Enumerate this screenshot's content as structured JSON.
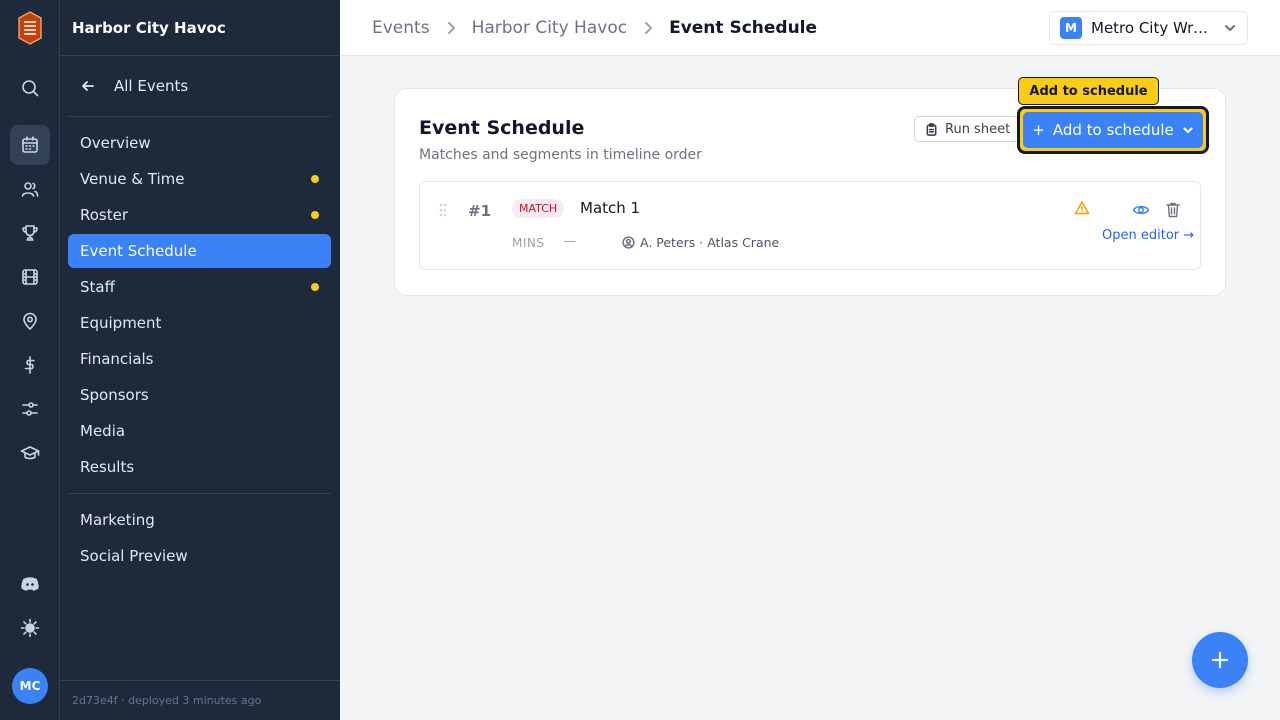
{
  "app": {
    "event_name": "Harbor City Havoc",
    "deploy_info": "2d73e4f · deployed 3 minutes ago",
    "user_initials": "MC"
  },
  "rail": {
    "icons": [
      "search-icon",
      "calendar-icon",
      "users-icon",
      "trophy-icon",
      "film-icon",
      "map-pin-icon",
      "dollar-icon",
      "sliders-icon",
      "graduation-cap-icon",
      "discord-icon",
      "sun-icon"
    ],
    "active": "calendar-icon"
  },
  "panel": {
    "back_label": "All Events",
    "items": [
      {
        "label": "Overview",
        "dot": false
      },
      {
        "label": "Venue & Time",
        "dot": true
      },
      {
        "label": "Roster",
        "dot": true
      },
      {
        "label": "Event Schedule",
        "dot": false,
        "active": true
      },
      {
        "label": "Staff",
        "dot": true
      },
      {
        "label": "Equipment",
        "dot": false
      },
      {
        "label": "Financials",
        "dot": false
      },
      {
        "label": "Sponsors",
        "dot": false
      },
      {
        "label": "Media",
        "dot": false
      },
      {
        "label": "Results",
        "dot": false
      }
    ],
    "extra_items": [
      {
        "label": "Marketing"
      },
      {
        "label": "Social Preview"
      }
    ]
  },
  "header": {
    "breadcrumbs": [
      "Events",
      "Harbor City Havoc",
      "Event Schedule"
    ],
    "org_initial": "M",
    "org_name": "Metro City Wres..."
  },
  "schedule": {
    "title": "Event Schedule",
    "subtitle": "Matches and segments in timeline order",
    "run_sheet_label": "Run sheet",
    "add_label": "Add to schedule",
    "tooltip": "Add to schedule",
    "items": [
      {
        "number": "#1",
        "type": "MATCH",
        "name": "Match 1",
        "duration_unit": "MINS",
        "duration_value": "—",
        "participants": "A. Peters · Atlas Crane",
        "editor_label": "Open editor →",
        "warning": true
      }
    ]
  },
  "colors": {
    "sidebar_bg": "#1e293b",
    "accent": "#3b82f6",
    "highlight": "#facc15",
    "warning": "#f59e0b",
    "tag_bg": "#fce7f3",
    "tag_text": "#b91c1c"
  }
}
